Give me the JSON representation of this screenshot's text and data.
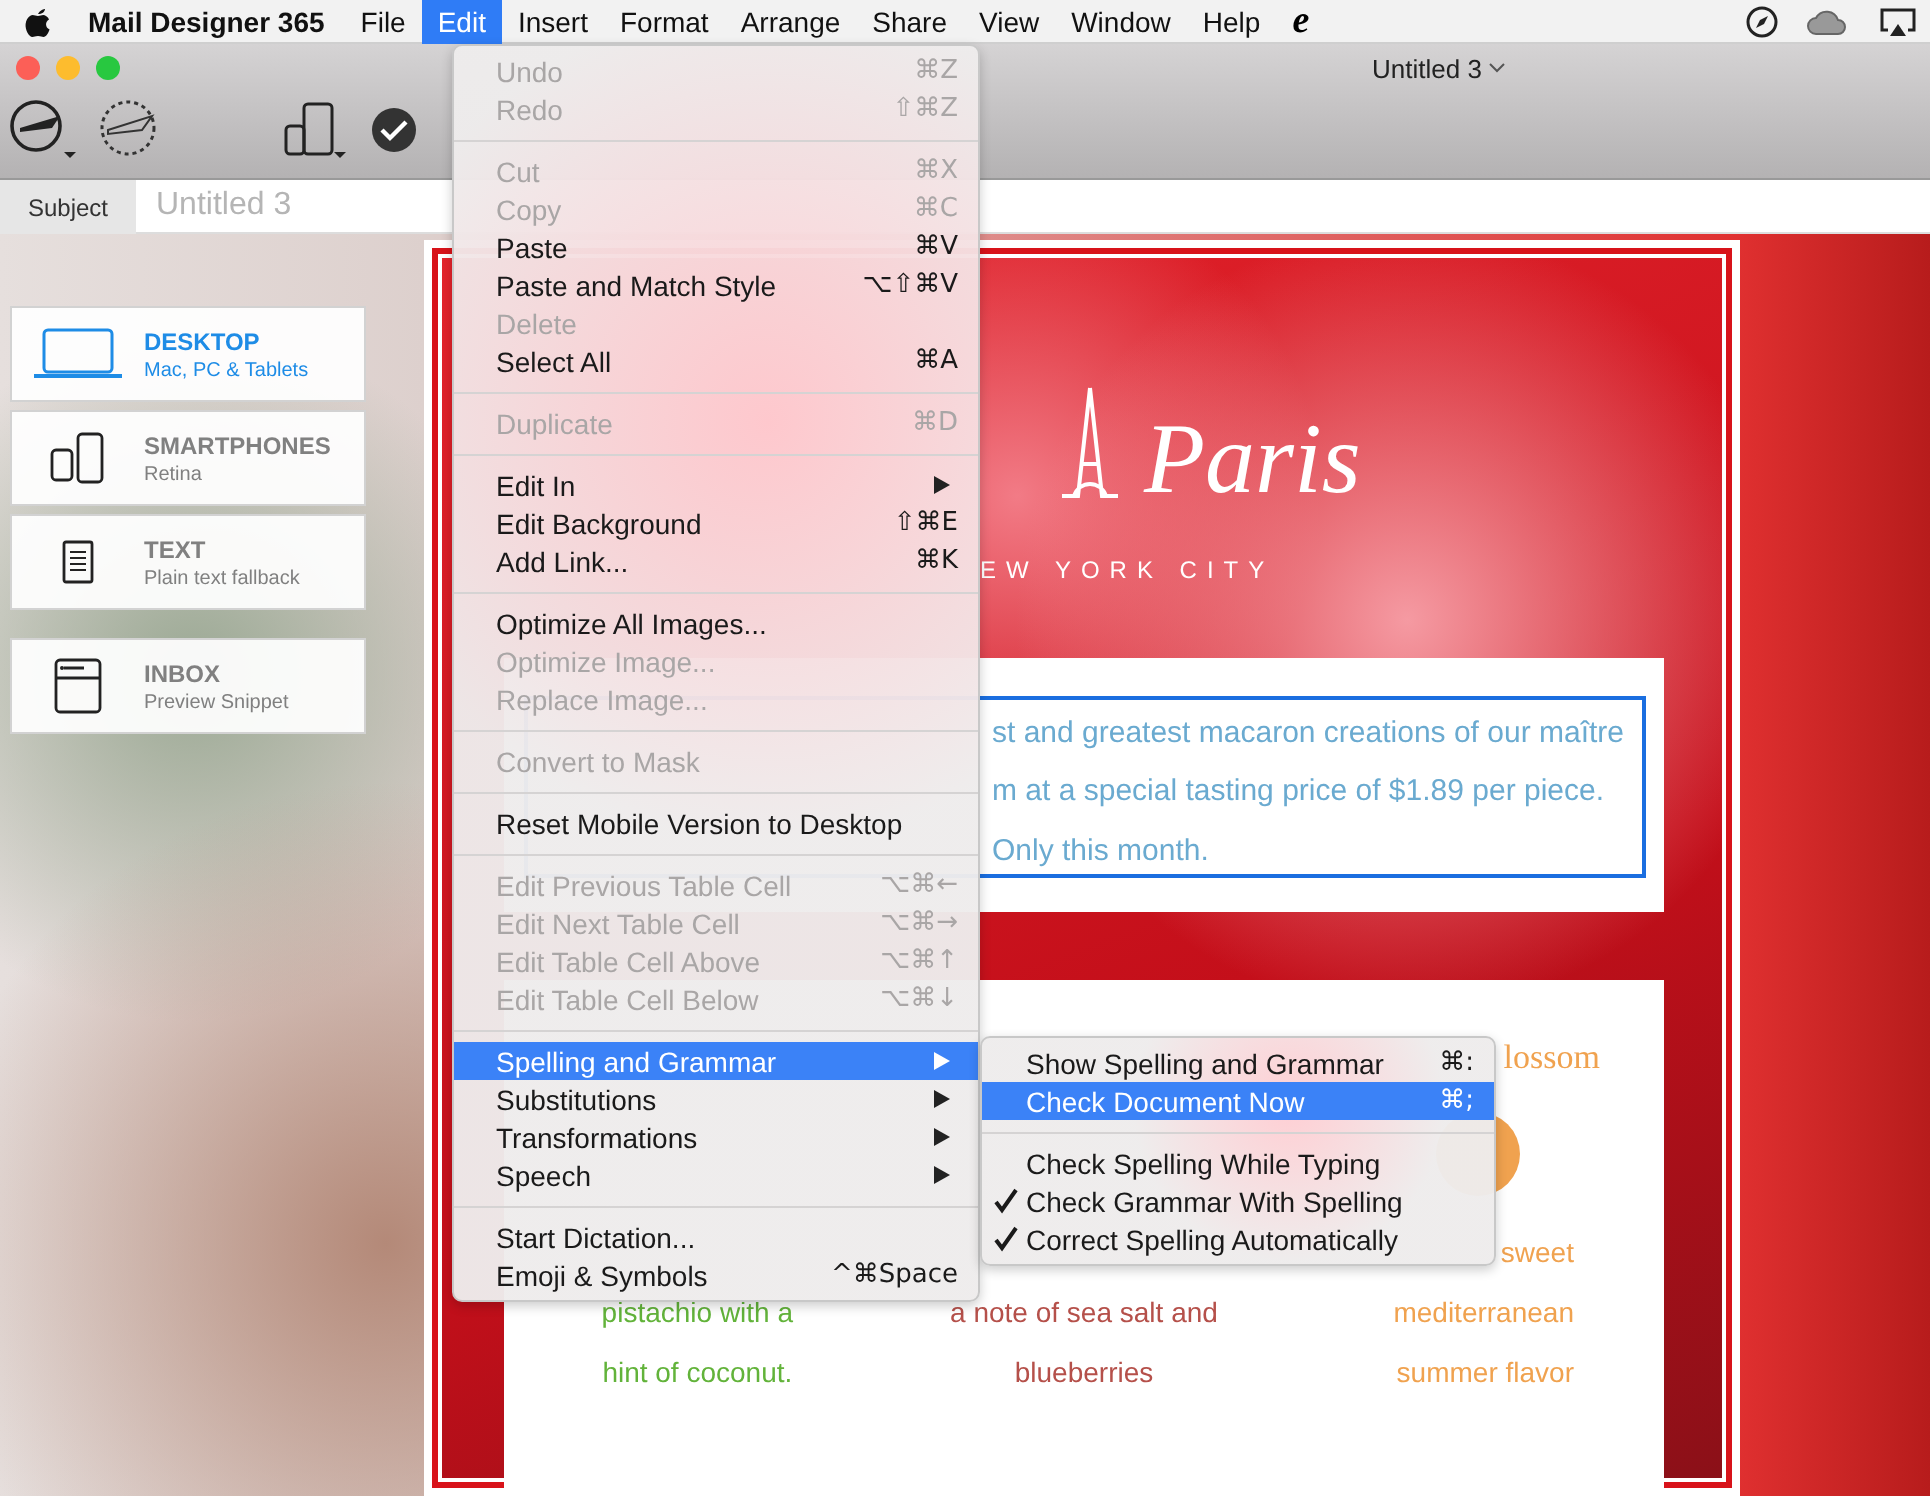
{
  "menubar": {
    "app_name": "Mail Designer 365",
    "menus": [
      {
        "label": "File",
        "selected": false
      },
      {
        "label": "Edit",
        "selected": true
      },
      {
        "label": "Insert",
        "selected": false
      },
      {
        "label": "Format",
        "selected": false
      },
      {
        "label": "Arrange",
        "selected": false
      },
      {
        "label": "Share",
        "selected": false
      },
      {
        "label": "View",
        "selected": false
      },
      {
        "label": "Window",
        "selected": false
      },
      {
        "label": "Help",
        "selected": false
      }
    ],
    "extra": "e"
  },
  "window": {
    "title": "Untitled 3"
  },
  "subject": {
    "label": "Subject",
    "placeholder": "Untitled 3"
  },
  "devices": [
    {
      "title": "DESKTOP",
      "subtitle": "Mac, PC & Tablets",
      "kind": "laptop",
      "selected": true
    },
    {
      "title": "SMARTPHONES",
      "subtitle": "Retina",
      "kind": "phone",
      "selected": false
    },
    {
      "title": "TEXT",
      "subtitle": "Plain text fallback",
      "kind": "text",
      "selected": false
    },
    {
      "title": "INBOX",
      "subtitle": "Preview Snippet",
      "kind": "inbox",
      "selected": false
    }
  ],
  "email": {
    "logo": "Paris",
    "tagline": "EW YORK CITY",
    "text_lines": [
      "st and greatest macaron creations of our maître",
      "m at a special tasting price of $1.89 per piece.",
      "Only this month."
    ],
    "products": [
      {
        "color": "#62b33a",
        "description": [
          "pistachio with a",
          "hint of coconut."
        ]
      },
      {
        "color": "#b5504a",
        "description": [
          "a note of sea salt and",
          "blueberries"
        ]
      },
      {
        "color": "#f0a24f",
        "title": "lossom",
        "description": [
          "sweet",
          "mediterranean",
          "summer flavor"
        ]
      }
    ]
  },
  "edit_menu": [
    {
      "kind": "item",
      "label": "Undo",
      "shortcut": "⌘Z",
      "disabled": true,
      "submenu": false,
      "selected": false
    },
    {
      "kind": "item",
      "label": "Redo",
      "shortcut": "⇧⌘Z",
      "disabled": true,
      "submenu": false,
      "selected": false
    },
    {
      "kind": "separator"
    },
    {
      "kind": "item",
      "label": "Cut",
      "shortcut": "⌘X",
      "disabled": true,
      "submenu": false,
      "selected": false
    },
    {
      "kind": "item",
      "label": "Copy",
      "shortcut": "⌘C",
      "disabled": true,
      "submenu": false,
      "selected": false
    },
    {
      "kind": "item",
      "label": "Paste",
      "shortcut": "⌘V",
      "disabled": false,
      "submenu": false,
      "selected": false
    },
    {
      "kind": "item",
      "label": "Paste and Match Style",
      "shortcut": "⌥⇧⌘V",
      "disabled": false,
      "submenu": false,
      "selected": false
    },
    {
      "kind": "item",
      "label": "Delete",
      "disabled": true,
      "submenu": false,
      "selected": false
    },
    {
      "kind": "item",
      "label": "Select All",
      "shortcut": "⌘A",
      "disabled": false,
      "submenu": false,
      "selected": false
    },
    {
      "kind": "separator"
    },
    {
      "kind": "item",
      "label": "Duplicate",
      "shortcut": "⌘D",
      "disabled": true,
      "submenu": false,
      "selected": false
    },
    {
      "kind": "separator"
    },
    {
      "kind": "item",
      "label": "Edit In",
      "disabled": false,
      "submenu": true,
      "selected": false
    },
    {
      "kind": "item",
      "label": "Edit Background",
      "shortcut": "⇧⌘E",
      "disabled": false,
      "submenu": false,
      "selected": false
    },
    {
      "kind": "item",
      "label": "Add Link...",
      "shortcut": "⌘K",
      "disabled": false,
      "submenu": false,
      "selected": false
    },
    {
      "kind": "separator"
    },
    {
      "kind": "item",
      "label": "Optimize All Images...",
      "disabled": false,
      "submenu": false,
      "selected": false
    },
    {
      "kind": "item",
      "label": "Optimize Image...",
      "disabled": true,
      "submenu": false,
      "selected": false
    },
    {
      "kind": "item",
      "label": "Replace Image...",
      "disabled": true,
      "submenu": false,
      "selected": false
    },
    {
      "kind": "separator"
    },
    {
      "kind": "item",
      "label": "Convert to Mask",
      "disabled": true,
      "submenu": false,
      "selected": false
    },
    {
      "kind": "separator"
    },
    {
      "kind": "item",
      "label": "Reset Mobile Version to Desktop",
      "disabled": false,
      "submenu": false,
      "selected": false
    },
    {
      "kind": "separator"
    },
    {
      "kind": "item",
      "label": "Edit Previous Table Cell",
      "shortcut": "⌥⌘←",
      "disabled": true,
      "submenu": false,
      "selected": false
    },
    {
      "kind": "item",
      "label": "Edit Next Table Cell",
      "shortcut": "⌥⌘→",
      "disabled": true,
      "submenu": false,
      "selected": false
    },
    {
      "kind": "item",
      "label": "Edit Table Cell Above",
      "shortcut": "⌥⌘↑",
      "disabled": true,
      "submenu": false,
      "selected": false
    },
    {
      "kind": "item",
      "label": "Edit Table Cell Below",
      "shortcut": "⌥⌘↓",
      "disabled": true,
      "submenu": false,
      "selected": false
    },
    {
      "kind": "separator"
    },
    {
      "kind": "item",
      "label": "Spelling and Grammar",
      "disabled": false,
      "submenu": true,
      "selected": true
    },
    {
      "kind": "item",
      "label": "Substitutions",
      "disabled": false,
      "submenu": true,
      "selected": false
    },
    {
      "kind": "item",
      "label": "Transformations",
      "disabled": false,
      "submenu": true,
      "selected": false
    },
    {
      "kind": "item",
      "label": "Speech",
      "disabled": false,
      "submenu": true,
      "selected": false
    },
    {
      "kind": "separator"
    },
    {
      "kind": "item",
      "label": "Start Dictation...",
      "disabled": false,
      "submenu": false,
      "selected": false
    },
    {
      "kind": "item",
      "label": "Emoji & Symbols",
      "shortcut": "^⌘Space",
      "disabled": false,
      "submenu": false,
      "selected": false
    }
  ],
  "spelling_submenu": [
    {
      "kind": "item",
      "label": "Show Spelling and Grammar",
      "shortcut": "⌘:",
      "checked": false,
      "selected": false
    },
    {
      "kind": "item",
      "label": "Check Document Now",
      "shortcut": "⌘;",
      "checked": false,
      "selected": true
    },
    {
      "kind": "separator"
    },
    {
      "kind": "item",
      "label": "Check Spelling While Typing",
      "checked": false,
      "selected": false
    },
    {
      "kind": "item",
      "label": "Check Grammar With Spelling",
      "checked": true,
      "selected": false
    },
    {
      "kind": "item",
      "label": "Correct Spelling Automatically",
      "checked": true,
      "selected": false
    }
  ]
}
